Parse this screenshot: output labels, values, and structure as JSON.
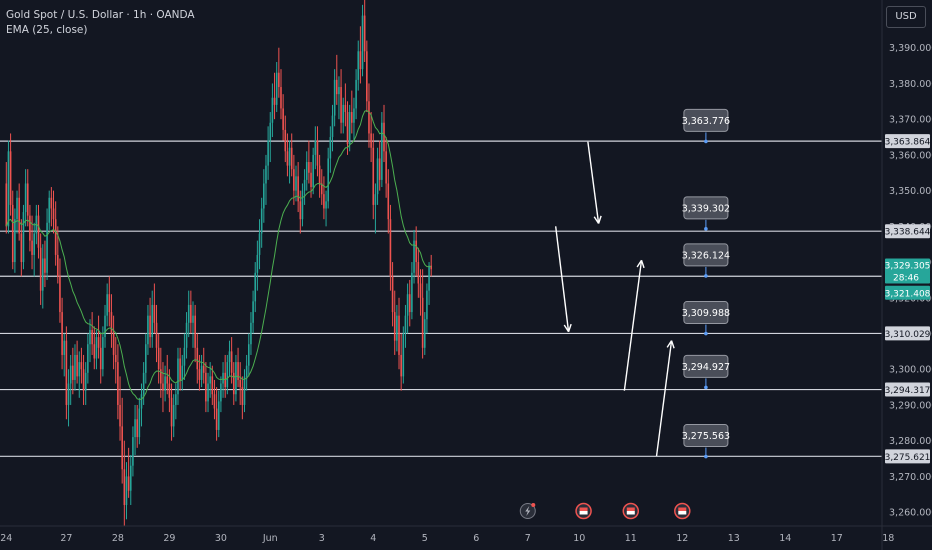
{
  "header": {
    "symbol_line": "Gold Spot / U.S. Dollar · 1h · OANDA",
    "indicator_line": "EMA (25, close)"
  },
  "currency_button": "USD",
  "colors": {
    "background": "#131722",
    "up": "#26a69a",
    "down": "#ef5350",
    "ema": "#4caf50",
    "level_line": "#d1d4dc",
    "axis_text": "#b2b5be",
    "label_box": "#4a4e59",
    "label_border": "#9598a1",
    "current_price_bg": "#26a69a"
  },
  "chart_data": {
    "type": "candlestick",
    "symbol": "XAUUSD",
    "timeframe": "1h",
    "y_axis": {
      "ylim": [
        3255,
        3400
      ],
      "ticks": [
        3260,
        3270,
        3280,
        3290,
        3300,
        3310,
        3320,
        3330,
        3340,
        3350,
        3360,
        3370,
        3380,
        3390
      ],
      "tick_labels": [
        "3,260.000",
        "3,270.000",
        "3,280.000",
        "3,290.000",
        "3,300.000",
        "3,310.000",
        "3,320.000",
        "3,330.000",
        "3,340.000",
        "3,350.000",
        "3,360.000",
        "3,370.000",
        "3,380.000",
        "3,390.000"
      ]
    },
    "x_axis": {
      "labels": [
        "24",
        "27",
        "28",
        "29",
        "30",
        "Jun",
        "3",
        "4",
        "5",
        "6",
        "7",
        "10",
        "11",
        "12",
        "13",
        "14",
        "17",
        "18"
      ],
      "label_index": [
        0,
        28,
        52,
        76,
        100,
        123,
        147,
        171,
        195,
        219,
        243,
        267,
        291,
        315,
        339,
        363,
        387,
        411
      ]
    },
    "candles": [
      [
        3352,
        3358,
        3338,
        3340
      ],
      [
        3340,
        3364,
        3338,
        3361
      ],
      [
        3361,
        3366,
        3343,
        3346
      ],
      [
        3346,
        3350,
        3328,
        3330
      ],
      [
        3330,
        3345,
        3327,
        3342
      ],
      [
        3342,
        3350,
        3338,
        3348
      ],
      [
        3348,
        3352,
        3336,
        3338
      ],
      [
        3338,
        3342,
        3326,
        3330
      ],
      [
        3330,
        3346,
        3328,
        3344
      ],
      [
        3344,
        3356,
        3340,
        3352
      ],
      [
        3352,
        3356,
        3340,
        3343
      ],
      [
        3343,
        3346,
        3333,
        3336
      ],
      [
        3336,
        3343,
        3328,
        3332
      ],
      [
        3332,
        3341,
        3326,
        3338
      ],
      [
        3338,
        3346,
        3335,
        3343
      ],
      [
        3343,
        3346,
        3331,
        3334
      ],
      [
        3334,
        3338,
        3318,
        3322
      ],
      [
        3322,
        3335,
        3317,
        3331
      ],
      [
        3331,
        3336,
        3323,
        3327
      ],
      [
        3327,
        3345,
        3325,
        3341
      ],
      [
        3341,
        3350,
        3339,
        3348
      ],
      [
        3348,
        3351,
        3340,
        3345
      ],
      [
        3345,
        3350,
        3338,
        3342
      ],
      [
        3342,
        3347,
        3329,
        3332
      ],
      [
        3332,
        3340,
        3324,
        3326
      ],
      [
        3326,
        3331,
        3313,
        3316
      ],
      [
        3316,
        3320,
        3300,
        3304
      ],
      [
        3304,
        3310,
        3298,
        3308
      ],
      [
        3308,
        3312,
        3286,
        3290
      ],
      [
        3290,
        3300,
        3284,
        3296
      ],
      [
        3296,
        3304,
        3290,
        3301
      ],
      [
        3301,
        3306,
        3293,
        3297
      ],
      [
        3297,
        3307,
        3294,
        3304
      ],
      [
        3304,
        3308,
        3296,
        3298
      ],
      [
        3298,
        3305,
        3292,
        3302
      ],
      [
        3302,
        3306,
        3296,
        3300
      ],
      [
        3300,
        3304,
        3290,
        3294
      ],
      [
        3294,
        3302,
        3290,
        3299
      ],
      [
        3299,
        3310,
        3296,
        3307
      ],
      [
        3307,
        3314,
        3302,
        3311
      ],
      [
        3311,
        3316,
        3304,
        3307
      ],
      [
        3307,
        3312,
        3300,
        3303
      ],
      [
        3303,
        3311,
        3300,
        3309
      ],
      [
        3309,
        3315,
        3303,
        3306
      ],
      [
        3306,
        3310,
        3296,
        3300
      ],
      [
        3300,
        3312,
        3298,
        3309
      ],
      [
        3309,
        3318,
        3306,
        3315
      ],
      [
        3315,
        3324,
        3312,
        3321
      ],
      [
        3321,
        3326,
        3312,
        3316
      ],
      [
        3316,
        3321,
        3306,
        3310
      ],
      [
        3310,
        3315,
        3300,
        3304
      ],
      [
        3304,
        3309,
        3296,
        3302
      ],
      [
        3302,
        3307,
        3286,
        3290
      ],
      [
        3290,
        3298,
        3280,
        3284
      ],
      [
        3284,
        3292,
        3268,
        3272
      ],
      [
        3272,
        3280,
        3256,
        3262
      ],
      [
        3262,
        3274,
        3258,
        3270
      ],
      [
        3270,
        3278,
        3264,
        3266
      ],
      [
        3266,
        3276,
        3262,
        3273
      ],
      [
        3273,
        3284,
        3270,
        3281
      ],
      [
        3281,
        3290,
        3276,
        3286
      ],
      [
        3286,
        3290,
        3278,
        3281
      ],
      [
        3281,
        3292,
        3279,
        3289
      ],
      [
        3289,
        3296,
        3284,
        3293
      ],
      [
        3293,
        3302,
        3290,
        3299
      ],
      [
        3299,
        3310,
        3296,
        3307
      ],
      [
        3307,
        3318,
        3304,
        3315
      ],
      [
        3315,
        3320,
        3306,
        3309
      ],
      [
        3309,
        3322,
        3306,
        3318
      ],
      [
        3318,
        3324,
        3310,
        3313
      ],
      [
        3313,
        3318,
        3302,
        3306
      ],
      [
        3306,
        3310,
        3296,
        3300
      ],
      [
        3300,
        3306,
        3292,
        3296
      ],
      [
        3296,
        3302,
        3288,
        3294
      ],
      [
        3294,
        3301,
        3291,
        3298
      ],
      [
        3298,
        3304,
        3293,
        3296
      ],
      [
        3296,
        3300,
        3288,
        3292
      ],
      [
        3292,
        3296,
        3280,
        3284
      ],
      [
        3284,
        3293,
        3281,
        3290
      ],
      [
        3290,
        3296,
        3286,
        3293
      ],
      [
        3293,
        3306,
        3290,
        3303
      ],
      [
        3303,
        3306,
        3294,
        3297
      ],
      [
        3297,
        3304,
        3294,
        3301
      ],
      [
        3301,
        3310,
        3297,
        3306
      ],
      [
        3306,
        3316,
        3303,
        3313
      ],
      [
        3313,
        3322,
        3309,
        3318
      ],
      [
        3318,
        3322,
        3310,
        3313
      ],
      [
        3313,
        3319,
        3306,
        3315
      ],
      [
        3315,
        3318,
        3302,
        3306
      ],
      [
        3306,
        3310,
        3296,
        3300
      ],
      [
        3300,
        3304,
        3294,
        3297
      ],
      [
        3297,
        3304,
        3295,
        3301
      ],
      [
        3301,
        3306,
        3296,
        3299
      ],
      [
        3299,
        3302,
        3288,
        3291
      ],
      [
        3291,
        3299,
        3288,
        3296
      ],
      [
        3296,
        3302,
        3292,
        3298
      ],
      [
        3298,
        3301,
        3290,
        3293
      ],
      [
        3293,
        3297,
        3286,
        3289
      ],
      [
        3289,
        3295,
        3280,
        3283
      ],
      [
        3283,
        3294,
        3281,
        3291
      ],
      [
        3291,
        3298,
        3288,
        3296
      ],
      [
        3296,
        3302,
        3292,
        3299
      ],
      [
        3299,
        3304,
        3292,
        3295
      ],
      [
        3295,
        3304,
        3293,
        3302
      ],
      [
        3302,
        3308,
        3298,
        3305
      ],
      [
        3305,
        3309,
        3296,
        3299
      ],
      [
        3299,
        3302,
        3290,
        3293
      ],
      [
        3293,
        3304,
        3291,
        3302
      ],
      [
        3302,
        3306,
        3295,
        3297
      ],
      [
        3297,
        3302,
        3290,
        3295
      ],
      [
        3295,
        3298,
        3286,
        3290
      ],
      [
        3290,
        3300,
        3288,
        3298
      ],
      [
        3298,
        3304,
        3294,
        3301
      ],
      [
        3301,
        3310,
        3298,
        3307
      ],
      [
        3307,
        3316,
        3304,
        3313
      ],
      [
        3313,
        3322,
        3310,
        3319
      ],
      [
        3319,
        3330,
        3316,
        3327
      ],
      [
        3327,
        3336,
        3322,
        3332
      ],
      [
        3332,
        3342,
        3328,
        3338
      ],
      [
        3338,
        3348,
        3334,
        3345
      ],
      [
        3345,
        3356,
        3341,
        3352
      ],
      [
        3352,
        3360,
        3346,
        3357
      ],
      [
        3357,
        3368,
        3353,
        3364
      ],
      [
        3364,
        3372,
        3358,
        3369
      ],
      [
        3369,
        3380,
        3365,
        3376
      ],
      [
        3376,
        3383,
        3370,
        3374
      ],
      [
        3374,
        3386,
        3372,
        3383
      ],
      [
        3383,
        3390,
        3376,
        3379
      ],
      [
        3379,
        3384,
        3370,
        3373
      ],
      [
        3373,
        3377,
        3364,
        3367
      ],
      [
        3367,
        3371,
        3358,
        3361
      ],
      [
        3361,
        3366,
        3354,
        3357
      ],
      [
        3357,
        3364,
        3352,
        3362
      ],
      [
        3362,
        3366,
        3354,
        3356
      ],
      [
        3356,
        3360,
        3346,
        3350
      ],
      [
        3350,
        3357,
        3347,
        3354
      ],
      [
        3354,
        3358,
        3344,
        3347
      ],
      [
        3347,
        3350,
        3338,
        3342
      ],
      [
        3342,
        3352,
        3340,
        3350
      ],
      [
        3350,
        3356,
        3346,
        3353
      ],
      [
        3353,
        3361,
        3350,
        3358
      ],
      [
        3358,
        3364,
        3352,
        3355
      ],
      [
        3355,
        3358,
        3348,
        3351
      ],
      [
        3351,
        3362,
        3349,
        3360
      ],
      [
        3360,
        3368,
        3356,
        3364
      ],
      [
        3364,
        3368,
        3354,
        3357
      ],
      [
        3357,
        3360,
        3348,
        3352
      ],
      [
        3352,
        3356,
        3346,
        3349
      ],
      [
        3349,
        3354,
        3342,
        3345
      ],
      [
        3345,
        3350,
        3340,
        3347
      ],
      [
        3347,
        3362,
        3345,
        3359
      ],
      [
        3359,
        3368,
        3355,
        3365
      ],
      [
        3365,
        3374,
        3361,
        3371
      ],
      [
        3371,
        3384,
        3368,
        3381
      ],
      [
        3381,
        3388,
        3374,
        3377
      ],
      [
        3377,
        3382,
        3370,
        3379
      ],
      [
        3379,
        3384,
        3366,
        3369
      ],
      [
        3369,
        3376,
        3366,
        3374
      ],
      [
        3374,
        3380,
        3368,
        3372
      ],
      [
        3372,
        3375,
        3360,
        3363
      ],
      [
        3363,
        3374,
        3361,
        3372
      ],
      [
        3372,
        3378,
        3366,
        3369
      ],
      [
        3369,
        3376,
        3364,
        3373
      ],
      [
        3373,
        3384,
        3370,
        3381
      ],
      [
        3381,
        3392,
        3378,
        3389
      ],
      [
        3389,
        3396,
        3380,
        3384
      ],
      [
        3384,
        3402,
        3382,
        3399
      ],
      [
        3399,
        3404,
        3386,
        3389
      ],
      [
        3389,
        3392,
        3372,
        3375
      ],
      [
        3375,
        3380,
        3362,
        3366
      ],
      [
        3366,
        3372,
        3358,
        3362
      ],
      [
        3362,
        3366,
        3342,
        3346
      ],
      [
        3346,
        3352,
        3338,
        3349
      ],
      [
        3349,
        3362,
        3346,
        3359
      ],
      [
        3359,
        3364,
        3350,
        3353
      ],
      [
        3353,
        3372,
        3351,
        3369
      ],
      [
        3369,
        3374,
        3358,
        3361
      ],
      [
        3361,
        3365,
        3348,
        3352
      ],
      [
        3352,
        3356,
        3338,
        3342
      ],
      [
        3342,
        3346,
        3322,
        3326
      ],
      [
        3326,
        3330,
        3312,
        3316
      ],
      [
        3316,
        3322,
        3304,
        3308
      ],
      [
        3308,
        3318,
        3305,
        3315
      ],
      [
        3315,
        3320,
        3300,
        3304
      ],
      [
        3304,
        3310,
        3294,
        3298
      ],
      [
        3298,
        3312,
        3296,
        3310
      ],
      [
        3310,
        3318,
        3306,
        3315
      ],
      [
        3315,
        3324,
        3310,
        3321
      ],
      [
        3321,
        3325,
        3312,
        3316
      ],
      [
        3316,
        3330,
        3314,
        3327
      ],
      [
        3327,
        3339,
        3324,
        3336
      ],
      [
        3336,
        3340,
        3326,
        3330
      ],
      [
        3330,
        3334,
        3320,
        3324
      ],
      [
        3324,
        3328,
        3315,
        3320
      ],
      [
        3320,
        3328,
        3303,
        3306
      ],
      [
        3306,
        3316,
        3304,
        3314
      ],
      [
        3314,
        3324,
        3310,
        3322
      ],
      [
        3322,
        3330,
        3318,
        3329
      ],
      [
        3329,
        3332,
        3326,
        3328
      ]
    ],
    "ema": {
      "name": "EMA (25, close)",
      "period": 25
    },
    "levels": [
      3363.864,
      3338.644,
      3326.022,
      3310.029,
      3294.317,
      3275.621
    ],
    "level_labels": [
      "3,363.864",
      "3,338.644",
      "3,326.022",
      "3,310.029",
      "3,294.317",
      "3,275.621"
    ],
    "annotations": [
      {
        "value": 3363.776,
        "text": "3,363.776",
        "x_index": 326
      },
      {
        "value": 3339.302,
        "text": "3,339.302",
        "x_index": 326
      },
      {
        "value": 3326.124,
        "text": "3,326.124",
        "x_index": 326
      },
      {
        "value": 3309.988,
        "text": "3,309.988",
        "x_index": 326
      },
      {
        "value": 3294.927,
        "text": "3,294.927",
        "x_index": 326
      },
      {
        "value": 3275.563,
        "text": "3,275.563",
        "x_index": 326
      }
    ],
    "arrows": [
      {
        "from": [
          271,
          3363.7
        ],
        "to": [
          276,
          3340.8
        ],
        "direction": "down"
      },
      {
        "from": [
          256,
          3340.0
        ],
        "to": [
          262,
          3310.5
        ],
        "direction": "down"
      },
      {
        "from": [
          288,
          3294.0
        ],
        "to": [
          296,
          3330.5
        ],
        "direction": "up"
      },
      {
        "from": [
          303,
          3275.7
        ],
        "to": [
          310,
          3308.0
        ],
        "direction": "up"
      }
    ],
    "current_price": {
      "value": 3329.305,
      "text": "3,329.305",
      "countdown": "28:46"
    },
    "price_tags": [
      {
        "value": 3321.408,
        "text": "3,321.408",
        "color": "#26a69a"
      }
    ],
    "event_icons": [
      {
        "x_index": 243,
        "type": "lightning"
      },
      {
        "x_index": 269,
        "type": "flag"
      },
      {
        "x_index": 291,
        "type": "flag"
      },
      {
        "x_index": 315,
        "type": "flag"
      }
    ]
  }
}
